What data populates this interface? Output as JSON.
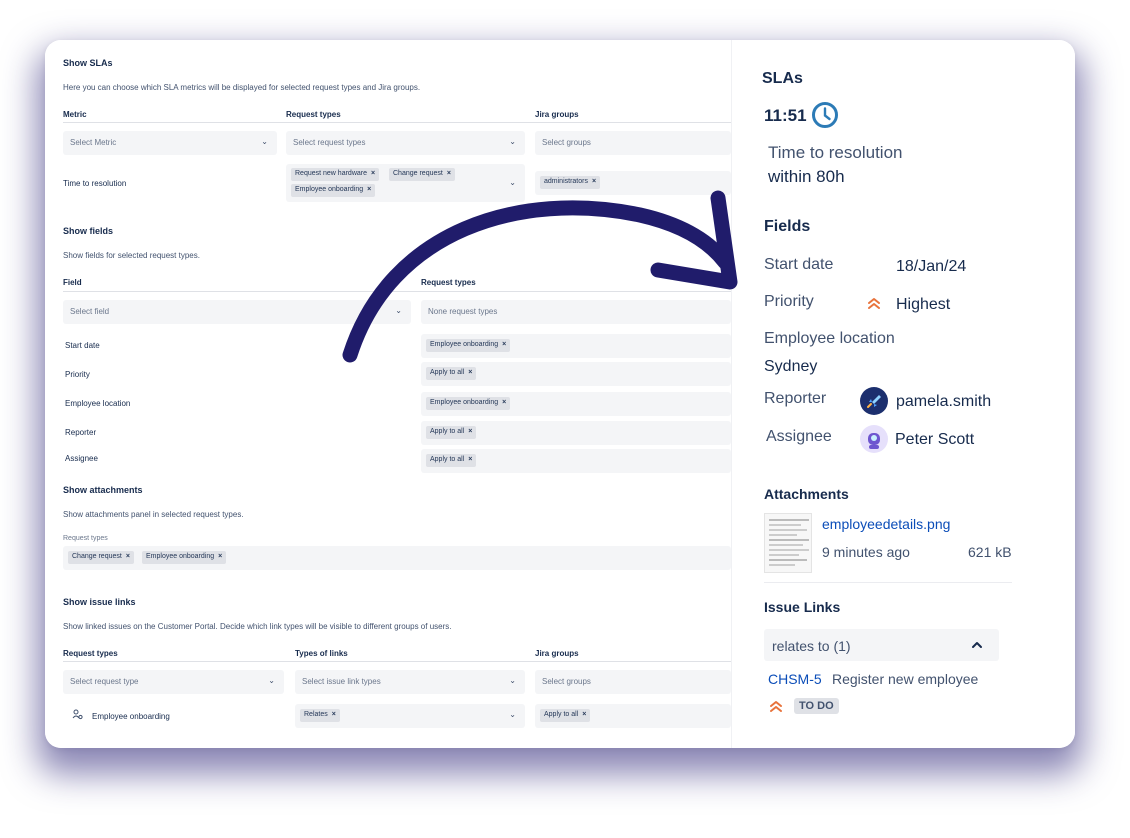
{
  "sla_config": {
    "title": "Show SLAs",
    "description": "Here you can choose which SLA metrics will be displayed for selected request types and Jira groups.",
    "columns": [
      "Metric",
      "Request types",
      "Jira groups"
    ],
    "metric_placeholder": "Select Metric",
    "request_types_placeholder": "Select request types",
    "groups_placeholder": "Select groups",
    "row": {
      "metric": "Time to resolution",
      "request_types": [
        "Request new hardware",
        "Change request",
        "Employee onboarding"
      ],
      "groups": [
        "administrators"
      ]
    }
  },
  "fields_config": {
    "title": "Show fields",
    "description": "Show fields for selected request types.",
    "columns": [
      "Field",
      "Request types"
    ],
    "field_placeholder": "Select field",
    "request_types_placeholder": "None request types",
    "rows": [
      {
        "field": "Start date",
        "tag": "Employee onboarding"
      },
      {
        "field": "Priority",
        "tag": "Apply to all"
      },
      {
        "field": "Employee location",
        "tag": "Employee onboarding"
      },
      {
        "field": "Reporter",
        "tag": "Apply to all"
      },
      {
        "field": "Assignee",
        "tag": "Apply to all"
      }
    ]
  },
  "attachments_config": {
    "title": "Show attachments",
    "description": "Show attachments panel in selected request types.",
    "label": "Request types",
    "tags": [
      "Change request",
      "Employee onboarding"
    ]
  },
  "links_config": {
    "title": "Show issue links",
    "description": "Show linked issues on the Customer Portal. Decide which link types will be visible to different groups of users.",
    "columns": [
      "Request types",
      "Types of links",
      "Jira groups"
    ],
    "request_type_placeholder": "Select request type",
    "link_types_placeholder": "Select issue link types",
    "groups_placeholder": "Select groups",
    "row": {
      "request_type": "Employee onboarding",
      "link_tag": "Relates",
      "group_tag": "Apply to all"
    }
  },
  "tag_remove_glyph": "×",
  "chevron_glyph": "⌄",
  "panel": {
    "slas_title": "SLAs",
    "sla_time": "11:51",
    "sla_name": "Time to resolution",
    "sla_goal": "within 80h",
    "fields_title": "Fields",
    "start_date_label": "Start date",
    "start_date_value": "18/Jan/24",
    "priority_label": "Priority",
    "priority_value": "Highest",
    "location_label": "Employee location",
    "location_value": "Sydney",
    "reporter_label": "Reporter",
    "reporter_value": "pamela.smith",
    "assignee_label": "Assignee",
    "assignee_value": "Peter Scott",
    "attachments_title": "Attachments",
    "attachment_name": "employeedetails.png",
    "attachment_time": "9 minutes ago",
    "attachment_size": "621 kB",
    "links_title": "Issue Links",
    "links_group": "relates to (1)",
    "linked_key": "CHSM-5",
    "linked_summary": "Register new employee",
    "linked_status": "TO DO"
  },
  "colors": {
    "accent_arrow": "#201c6b",
    "priority": "#e8733c",
    "link": "#0b4db8",
    "clock": "#2c7bb6"
  }
}
